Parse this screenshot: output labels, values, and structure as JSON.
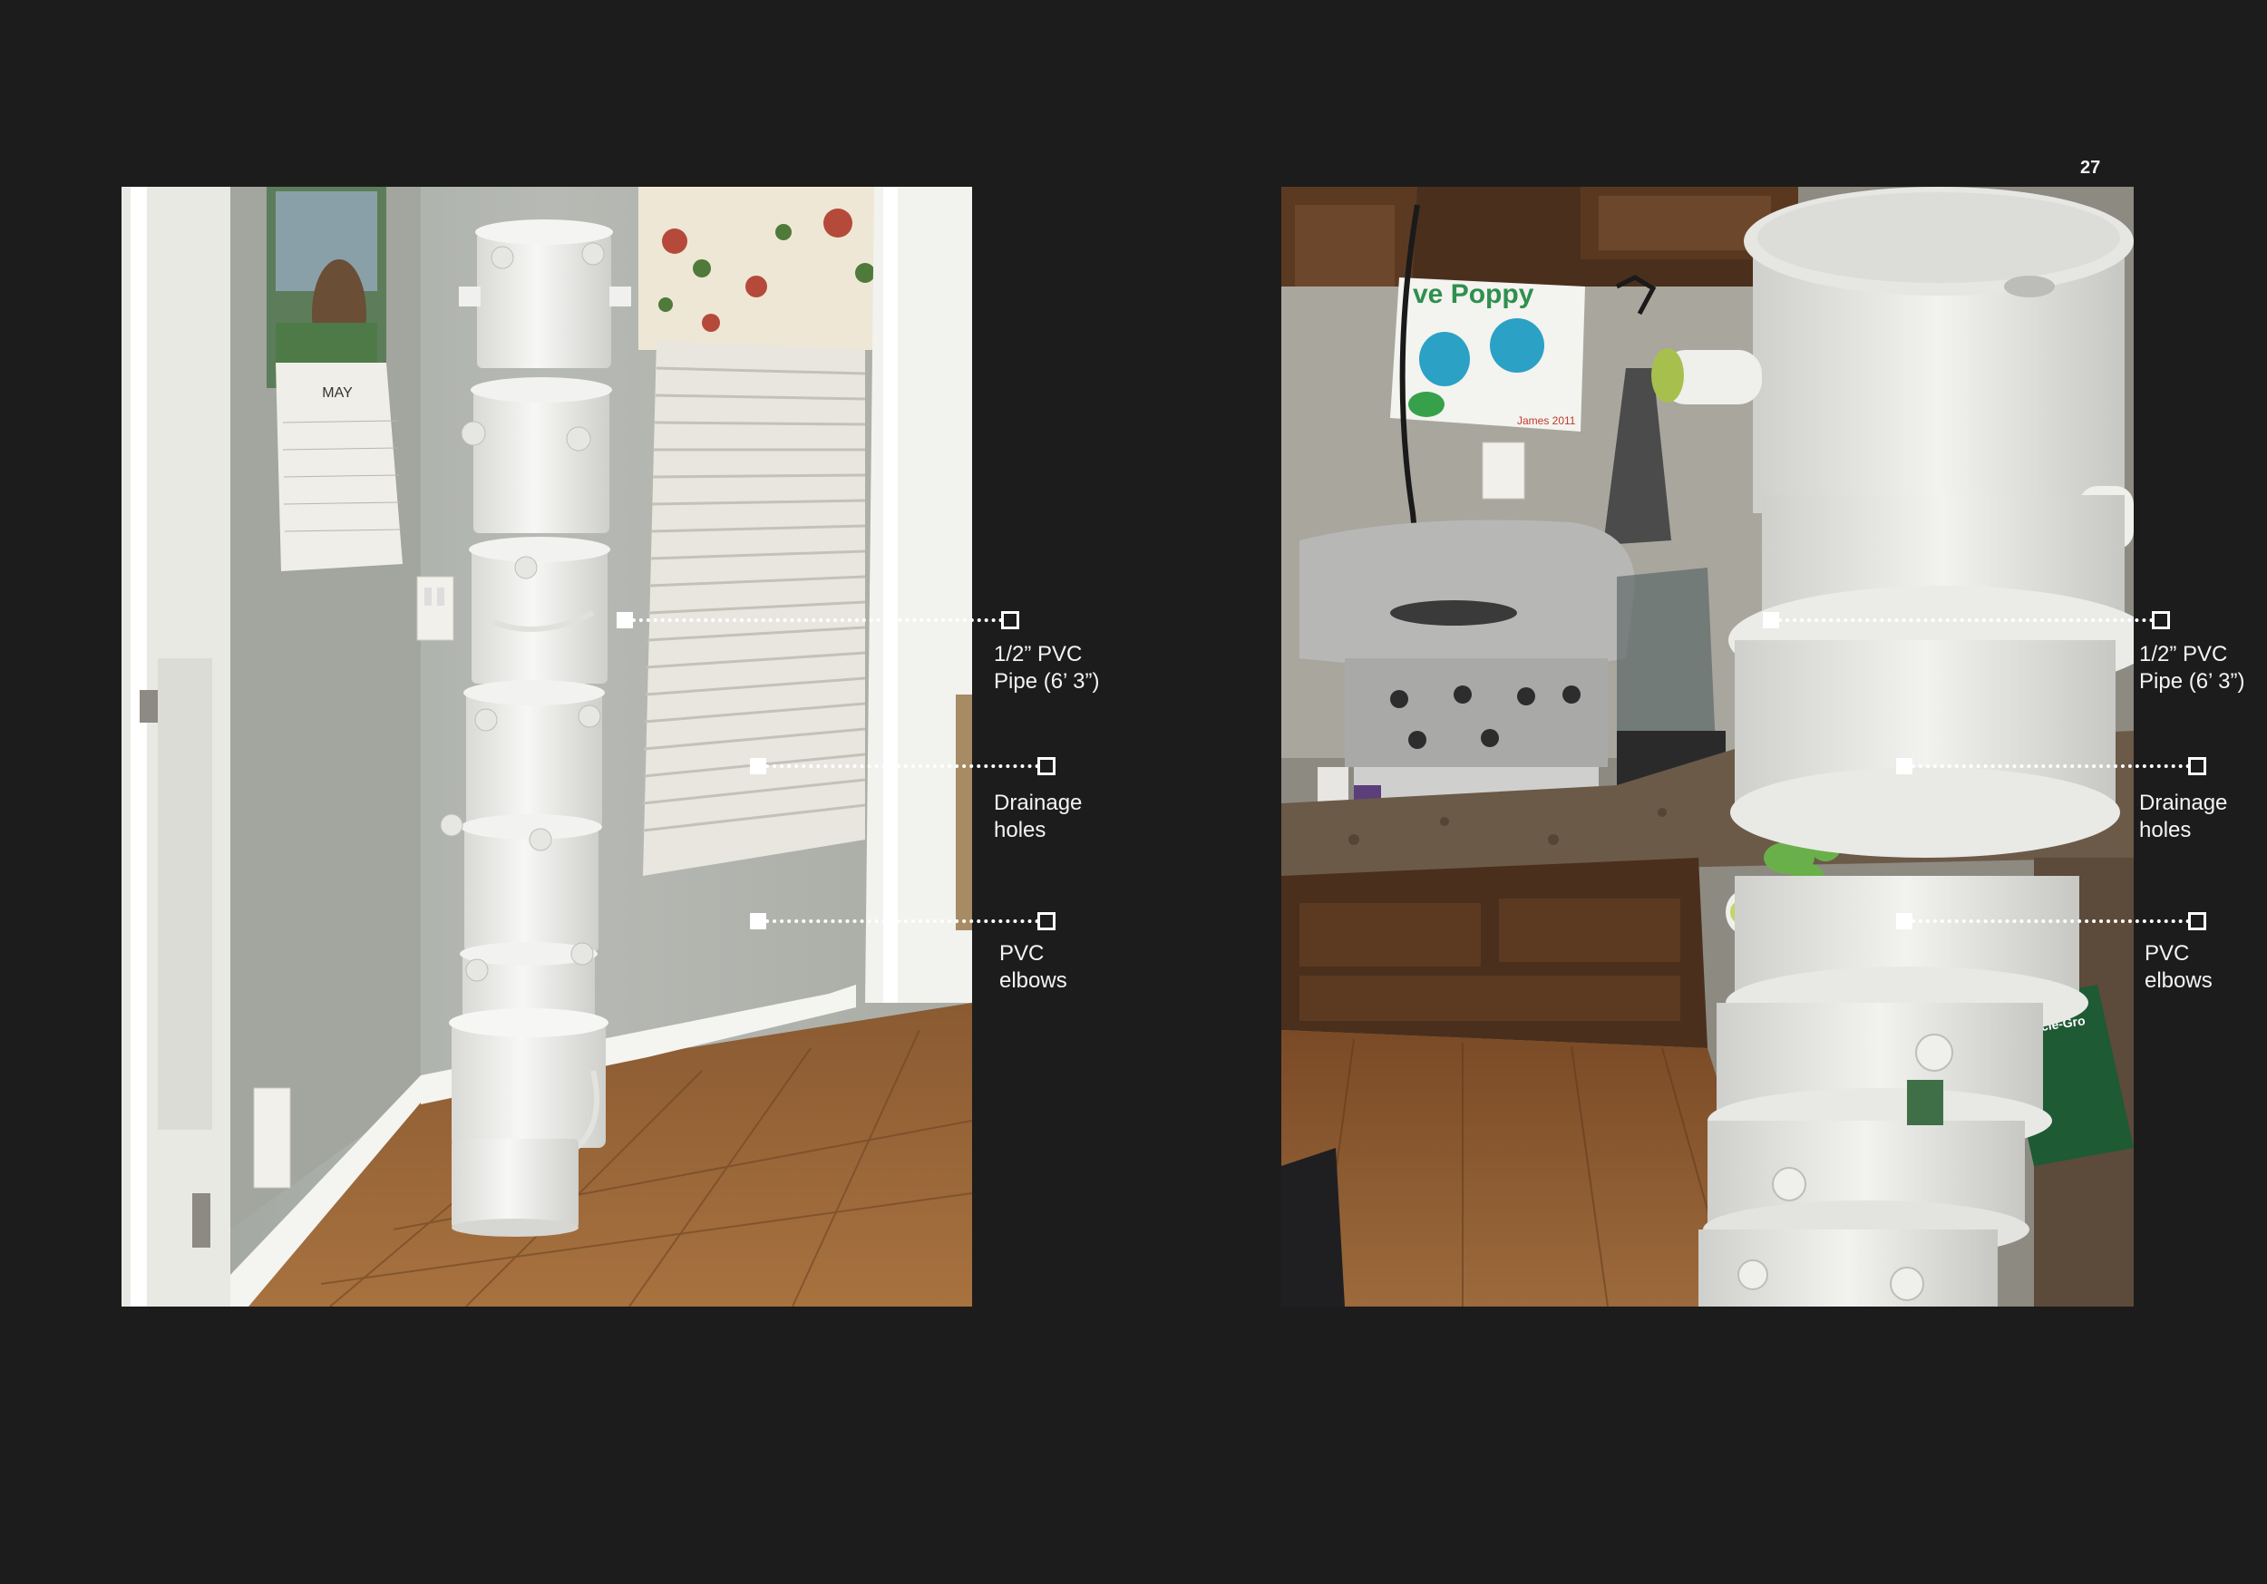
{
  "page": {
    "number": "27",
    "background": "#1c1c1c"
  },
  "left_photo": {
    "calendar_month": "MAY",
    "annotations": [
      {
        "id": "pvc-pipe",
        "line1": "1/2” PVC",
        "line2": "Pipe (6’ 3”)"
      },
      {
        "id": "drainage",
        "line1": "Drainage",
        "line2": "holes"
      },
      {
        "id": "elbows",
        "line1": "PVC",
        "line2": "elbows"
      }
    ]
  },
  "right_photo": {
    "artwork_text": "ve Poppy",
    "artwork_signature": "James 2011",
    "bag_brand": "Miracle-Gro",
    "annotations": [
      {
        "id": "pvc-pipe",
        "line1": "1/2” PVC",
        "line2": "Pipe (6’ 3”)"
      },
      {
        "id": "drainage",
        "line1": "Drainage",
        "line2": "holes"
      },
      {
        "id": "elbows",
        "line1": "PVC",
        "line2": "elbows"
      }
    ]
  }
}
